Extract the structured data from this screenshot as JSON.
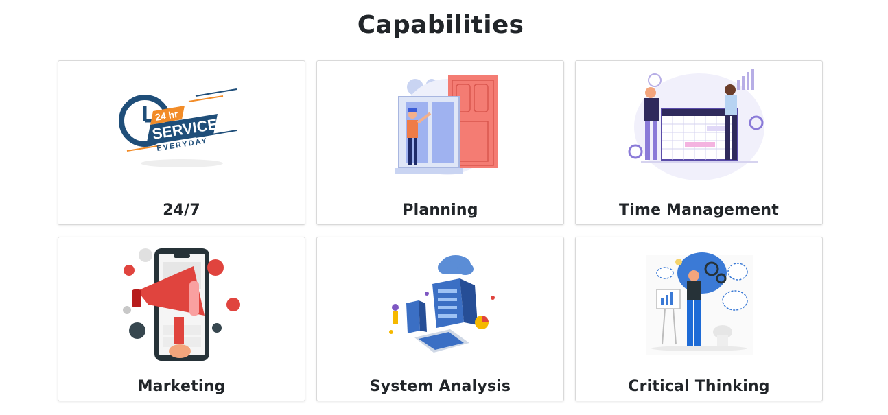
{
  "page": {
    "title": "Capabilities"
  },
  "cards": [
    {
      "title": "24/7",
      "art": {
        "badge_top": "24 hr",
        "badge_main": "SERVICE",
        "badge_sub": "EVERYDAY"
      }
    },
    {
      "title": "Planning"
    },
    {
      "title": "Time Management"
    },
    {
      "title": "Marketing"
    },
    {
      "title": "System Analysis"
    },
    {
      "title": "Critical Thinking"
    }
  ],
  "colors": {
    "navy": "#1f4e79",
    "orange": "#f28c28",
    "coral": "#f47c73",
    "purple": "#8a7ad8",
    "red": "#e0443e",
    "blue": "#3b7ad6"
  }
}
